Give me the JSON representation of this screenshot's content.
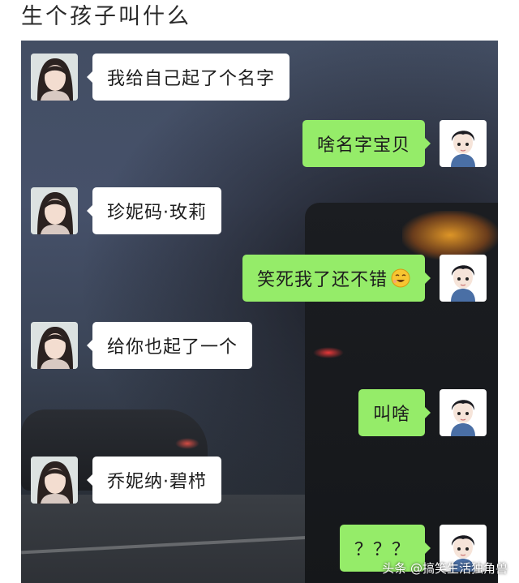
{
  "post": {
    "title": "生个孩子叫什么"
  },
  "chat": {
    "messages": [
      {
        "side": "in",
        "text": "我给自己起了个名字"
      },
      {
        "side": "out",
        "text": "啥名字宝贝"
      },
      {
        "side": "in",
        "text": "珍妮码·玫莉"
      },
      {
        "side": "out",
        "text": "笑死我了还不错",
        "emoji": "laughing-emoji"
      },
      {
        "side": "in",
        "text": "给你也起了一个"
      },
      {
        "side": "out",
        "text": "叫啥"
      },
      {
        "side": "in",
        "text": "乔妮纳·碧栉"
      },
      {
        "side": "out",
        "text": "？？？"
      }
    ],
    "colors": {
      "incoming_bubble": "#ffffff",
      "outgoing_bubble": "#95ec69"
    }
  },
  "watermark": {
    "text": "头条 @搞笑生活独角兽"
  }
}
